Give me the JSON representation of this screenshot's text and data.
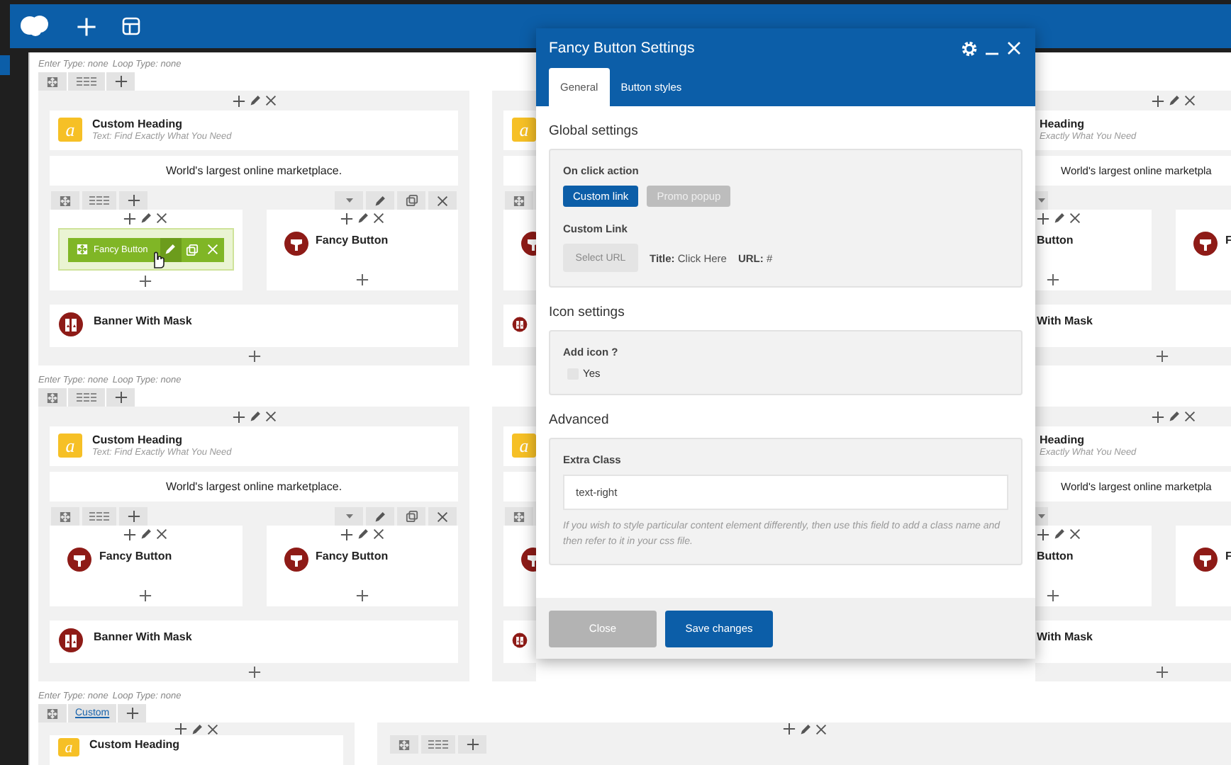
{
  "sections": [
    {
      "enter_type": "Enter Type: none",
      "loop_type": "Loop Type: none",
      "columns": [
        {
          "kind": "full",
          "items": [
            {
              "kind": "heading",
              "icon": "a",
              "title": "Custom Heading",
              "subtitle": "Text: Find Exactly What You Need"
            },
            {
              "kind": "text",
              "text": "World's largest online marketplace."
            },
            {
              "kind": "inner_row",
              "columns": [
                {
                  "element": {
                    "title": "Fancy Button",
                    "selected": true
                  }
                },
                {
                  "element": {
                    "title": "Fancy Button",
                    "selected": false
                  }
                }
              ]
            },
            {
              "kind": "banner",
              "title": "Banner With Mask"
            }
          ]
        },
        {
          "kind": "strip",
          "items": [
            {
              "kind": "heading",
              "icon": "a"
            },
            {
              "kind": "text"
            },
            {
              "kind": "inner_row",
              "columns": [
                {
                  "element": {
                    "selected": false
                  }
                }
              ]
            },
            {
              "kind": "banner"
            }
          ]
        },
        {
          "kind": "edge",
          "items": [
            {
              "kind": "heading",
              "title": "Heading",
              "subtitle": "Exactly What You Need"
            },
            {
              "kind": "text",
              "text": "World's largest online marketpla"
            },
            {
              "kind": "inner_row",
              "columns": [
                {
                  "element": {
                    "title": "Button",
                    "selected": false
                  }
                },
                {
                  "element": {
                    "title": "F",
                    "selected": false
                  }
                }
              ]
            },
            {
              "kind": "banner",
              "title": "With Mask"
            }
          ]
        }
      ]
    },
    {
      "enter_type": "Enter Type: none",
      "loop_type": "Loop Type: none",
      "columns": [
        {
          "kind": "full",
          "items": [
            {
              "kind": "heading",
              "icon": "a",
              "title": "Custom Heading",
              "subtitle": "Text: Find Exactly What You Need"
            },
            {
              "kind": "text",
              "text": "World's largest online marketplace."
            },
            {
              "kind": "inner_row",
              "columns": [
                {
                  "element": {
                    "title": "Fancy Button",
                    "selected": false
                  }
                },
                {
                  "element": {
                    "title": "Fancy Button",
                    "selected": false
                  }
                }
              ]
            },
            {
              "kind": "banner",
              "title": "Banner With Mask"
            }
          ]
        },
        {
          "kind": "strip",
          "items": [
            {
              "kind": "heading",
              "icon": "a"
            },
            {
              "kind": "text"
            },
            {
              "kind": "inner_row",
              "columns": [
                {
                  "element": {
                    "selected": false
                  }
                }
              ]
            },
            {
              "kind": "banner"
            }
          ]
        },
        {
          "kind": "edge",
          "items": [
            {
              "kind": "heading",
              "title": "Heading",
              "subtitle": "Exactly What You Need"
            },
            {
              "kind": "text",
              "text": "World's largest online marketpla"
            },
            {
              "kind": "inner_row",
              "columns": [
                {
                  "element": {
                    "title": "Button",
                    "selected": false
                  }
                },
                {
                  "element": {
                    "title": "F",
                    "selected": false
                  }
                }
              ]
            },
            {
              "kind": "banner",
              "title": "With Mask"
            }
          ]
        }
      ]
    },
    {
      "enter_type": "Enter Type: none",
      "loop_type": "Loop Type: none",
      "layout_label": "Custom",
      "columns": [
        {
          "kind": "full",
          "items": [
            {
              "kind": "heading",
              "icon": "a",
              "title": "Custom Heading"
            }
          ]
        },
        {
          "kind": "full",
          "items": [
            {
              "kind": "inner_row"
            }
          ]
        }
      ]
    }
  ],
  "dialog": {
    "title": "Fancy Button Settings",
    "tabs": [
      {
        "label": "General",
        "selected": true
      },
      {
        "label": "Button styles",
        "selected": false
      }
    ],
    "groups": [
      {
        "title": "Global settings",
        "fields": [
          {
            "kind": "choice",
            "label": "On click action",
            "options": [
              {
                "label": "Custom link",
                "selected": true
              },
              {
                "label": "Promo popup",
                "selected": false
              }
            ]
          },
          {
            "kind": "link",
            "label": "Custom Link",
            "button": "Select URL",
            "title": "**Title:** Click Here",
            "url": "**URL:** #"
          }
        ]
      },
      {
        "title": "Icon settings",
        "fields": [
          {
            "kind": "checkbox",
            "label": "Add icon ?",
            "option": "Yes",
            "checked": false
          }
        ]
      },
      {
        "title": "Advanced",
        "fields": [
          {
            "kind": "text",
            "label": "Extra Class",
            "value": "text-right",
            "help": "If you wish to style particular content element differently, then use this field to add a class name and then refer to it in your css file."
          }
        ]
      }
    ],
    "buttons": [
      {
        "label": "Close",
        "kind": "secondary"
      },
      {
        "label": "Save changes",
        "kind": "primary"
      }
    ]
  }
}
